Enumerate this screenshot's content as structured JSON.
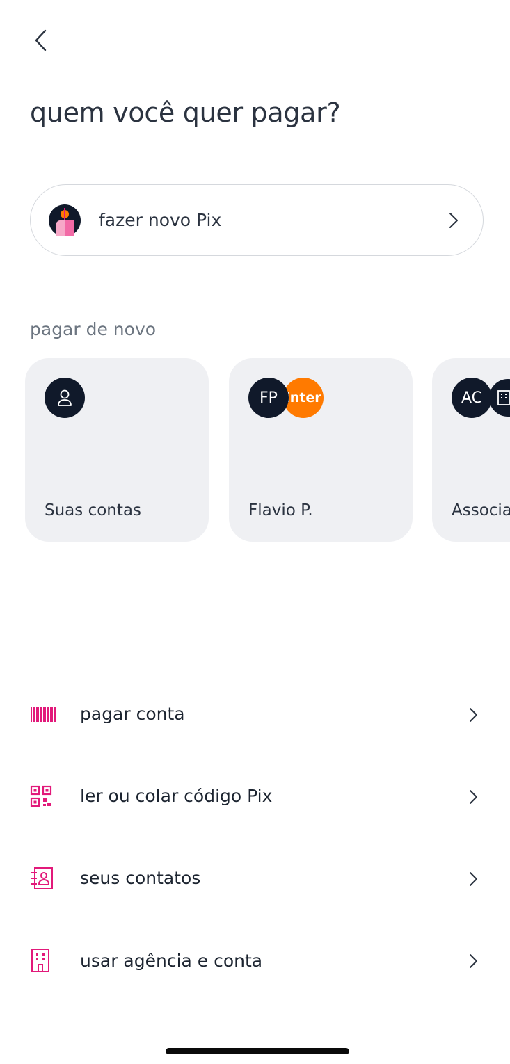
{
  "header": {
    "back_icon": "chevron-left-icon",
    "title": "quem você quer pagar?"
  },
  "new_pix": {
    "label": "fazer novo Pix",
    "avatar_icon": "pix-person-avatar-icon",
    "chevron_icon": "chevron-right-icon"
  },
  "recent": {
    "section_label": "pagar de novo",
    "cards": [
      {
        "name": "Suas contas",
        "avatar_icon": "person-icon"
      },
      {
        "name": "Flavio P.",
        "initials": "FP",
        "bank_logo_text": "inter"
      },
      {
        "name": "Associa",
        "initials": "AC",
        "second_icon": "building-icon"
      }
    ]
  },
  "menu": {
    "items": [
      {
        "label": "pagar conta",
        "icon": "barcode-icon"
      },
      {
        "label": "ler ou colar código Pix",
        "icon": "qr-code-icon"
      },
      {
        "label": "seus contatos",
        "icon": "contacts-book-icon"
      },
      {
        "label": "usar agência e conta",
        "icon": "building-icon"
      }
    ]
  },
  "colors": {
    "accent_pink": "#e2197a",
    "navy": "#10192a",
    "inter_orange": "#ff7a00",
    "card_bg": "#eff0f3"
  }
}
